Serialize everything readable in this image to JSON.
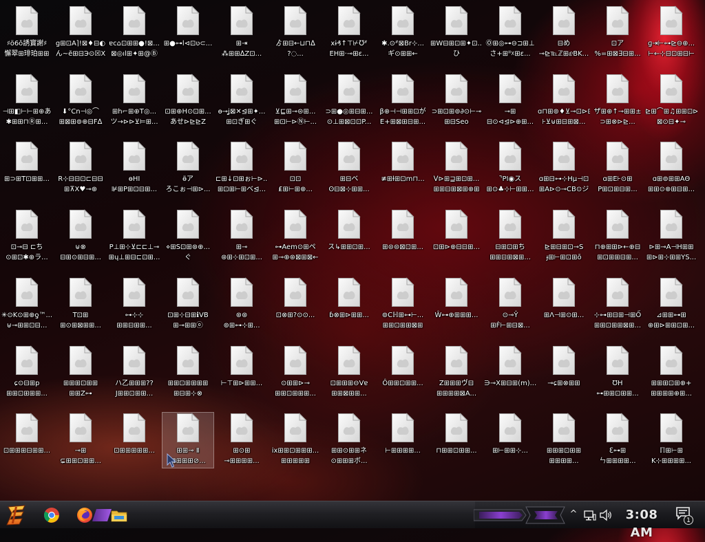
{
  "desktop": {
    "icon_type": "file-icon",
    "columns": 13,
    "icons": [
      {
        "line1": "♯ö6ǒ誘寳謝♯",
        "line2": "懈翠⊞琲珀⊞⊞"
      },
      {
        "line1": "g⊞⊡A⌉!⊠♦⊟◐",
        "line2": "ん~ẽ⊞⊟Э⊙☒X"
      },
      {
        "line1": "ɐc⌂⊡⊞⊞●!⊠...",
        "line2": "⊠◎ıl⊞✦⊞@Ⓑ"
      },
      {
        "line1": "⊞●⊶ⅼ⊲⊡ʋ⊂...",
        "line2": ""
      },
      {
        "line1": "⊞⇥",
        "line2": "⁂⊞⊞ᐃZ⊡..."
      },
      {
        "line1": "ゟ⊞⊟←⊔⊓ᐃ",
        "line2": "?◌..."
      },
      {
        "line1": "xɨ₰↑⊤⊬℧ᐥ",
        "line2": "EH⊞·⊸⊞ɛ..."
      },
      {
        "line1": "✱.⊙ᐥ⊠Br⊹...",
        "line2": "ギ⊙⊞⊞←"
      },
      {
        "line1": "⊞W⊟⊞⊡⊞✦⊡...",
        "line2": "ひ"
      },
      {
        "line1": "Ⓞ⊞◎⊶⊖⊐⊞⊥",
        "line2": "さ+⊞ᐦ☓⊞ɛ..."
      },
      {
        "line1": "⊟め",
        "line2": "⊸⊵℡ℤ⊞ⅇBK..."
      },
      {
        "line1": "⊡ア",
        "line2": "%=⊞⊠∃⊟⊞..."
      },
      {
        "line1": "ɡ⇥⊢⊶⊵⊖⊕...",
        "line2": "⊢←⊹⊟⊡⊞⊟⊢"
      },
      {
        "line1": "⊣⊞◧⊢⊢⊞⊕あ",
        "line2": "✱⊞⊞⊓Ⓡ⊞..."
      },
      {
        "line1": "⬇°Cn⊣◎⌒",
        "line2": "⊞⊠⊞⊚⊕⊟F∆"
      },
      {
        "line1": "⊞h⌐⊞⊕T◎...",
        "line2": "ツ→⊳⊳⊻⊨⊞..."
      },
      {
        "line1": "⊡⊞⊕H⊙⊡⊞...",
        "line2": "あせ⊳⊵⊵Z"
      },
      {
        "line1": "ɵ⊸ʝ⊠✕⊴⊞✦...",
        "line2": "⊞⊡ぎ⊞ぐ"
      },
      {
        "line1": "⊻⊑⊞⊸⊜⊞...",
        "line2": "⊞⊡⊢⊳Ⓝ⊢..."
      },
      {
        "line1": "⊃⊞●◎⊞⊟⊞...",
        "line2": "⊙⊥⊞⊠⊡⊡P..."
      },
      {
        "line1": "β⊕⊣⊣⊞⊞⊡が",
        "line2": "E+⊞⊠⊞⊟⊞..."
      },
      {
        "line1": "⊃⊞⊡⊞⊚∂⊙⊢⊸",
        "line2": "⊞⊟Seo"
      },
      {
        "line1": "⊸⊞",
        "line2": "⊟⊙⊲⊴⊳⊕⊞..."
      },
      {
        "line1": "ɑ⊓⊞⊚♦⊻⊸⊡⊳⊟",
        "line2": "⊦⊻⊎⊞⊟⊞⊠..."
      },
      {
        "line1": "ザ⊞⊕↑⊸⊞⊞±",
        "line2": "⊃⊞⊗⊳⊵..."
      },
      {
        "line1": "⊵⊞⌒⊞♫⊞⊞⊡⊳",
        "line2": "⊠⊙⊟✦⊸"
      },
      {
        "line1": "⊞⊃⊞T⊡⊞⊞...",
        "line2": ""
      },
      {
        "line1": "R⊹⊟⊟⊡⊏⊟⊟",
        "line2": "⊞⊼X♥⊸⊕"
      },
      {
        "line1": "ɵHI",
        "line2": "⊯⊞P⊞⊡⊟⊞..."
      },
      {
        "line1": "ɵ̃ア",
        "line2": "ろこぉ⊣⊞⊳..."
      },
      {
        "line1": "⊏⊞↓⊡⊞ぉ⊢⊳...",
        "line2": "⊞⊡⊞⊢⊞ベ⊴..."
      },
      {
        "line1": "⊡⊡",
        "line2": "₤⊞⊢⊞⊕..."
      },
      {
        "line1": "⊞⊟ベ",
        "line2": "ʘ⊟⊠⊹⊞⊞..."
      },
      {
        "line1": "≢⊞ƚ⊞⊡m⊓...",
        "line2": ""
      },
      {
        "line1": "ᐯ⊳⊞⊒⊞⊡⊞...",
        "line2": "⊞⊞⊟⊞⊠⊞⊕⊞"
      },
      {
        "line1": "⌝PI◉ス",
        "line2": "⊞⊙♣⊹⊢⊞⊞..."
      },
      {
        "line1": "ɑ⊞⊟⊶⊹Hμ⊣⊡",
        "line2": "⊞A⊳⊙⊸CB⊙ジ"
      },
      {
        "line1": "ɑ⊞E⊦⊙⊞",
        "line2": "P⊞⊡⊞⊟⊞..."
      },
      {
        "line1": "ɑ⊞⊚⊞⊞AΘ",
        "line2": "⊞⊞⊙⊕⊞⊟⊞..."
      },
      {
        "line1": "⊡⊸⊟ ⊏ち",
        "line2": "⊙⊞⊡✱⊕ラ..."
      },
      {
        "line1": "⊎⊗",
        "line2": "⊟⊞⊙⊞⊟⊞..."
      },
      {
        "line1": "P⊥⊞⊹⊻⊏⊏⊥⊸",
        "line2": "⊞ɥ⊥⊞⊟⊏⊡⊞..."
      },
      {
        "line1": "⋄⊞S⊡⊞⊛⊕...",
        "line2": "ぐ"
      },
      {
        "line1": "⊞⊸",
        "line2": "⊛⊞⊹⊞⊡⊞..."
      },
      {
        "line1": "⊶Aem⊙⊞ペ",
        "line2": "⊞⊸⊕⊛⊠⊞⊠←"
      },
      {
        "line1": "ス↳⊞⊞⊡⊞...",
        "line2": ""
      },
      {
        "line1": "⊞⊜⊜⊠⊡⊞...",
        "line2": ""
      },
      {
        "line1": "⊡⊞⊳⊕⊟⊟⊞...",
        "line2": ""
      },
      {
        "line1": "⊟⊞⊡⊞ち",
        "line2": "⊞⊞⊟⊞⊠⊞..."
      },
      {
        "line1": "⊵⊞⊟⊞⊡⊸S",
        "line2": "ɟ⊞⊢⊞⊡⊞ō"
      },
      {
        "line1": "⊓⊕⊞⊞⊳←⊕⊟",
        "line2": "⊞⊡⊞⊞⊟⊞..."
      },
      {
        "line1": "⊳⊞⊸A⊣H⊞⊞",
        "line2": "⊞⊳⊞⊹⊞⊞YS..."
      },
      {
        "line1": "✳⊙K⊙⊞⊕ƍ™...",
        "line2": "⊎⊸⊞⊞⊡⊟..."
      },
      {
        "line1": "T⊡⊞",
        "line2": "⊞⊙⊞⊠⊞⊞..."
      },
      {
        "line1": "⊶⊹⊹",
        "line2": "⊞⊞⊟⊞⊞..."
      },
      {
        "line1": "⊡⊞⊹⊟⊞ℹVB",
        "line2": "⊞⊸⊞⊞ⓞ"
      },
      {
        "line1": "⊛⊛",
        "line2": "⊚⊞⊶⊹⊞..."
      },
      {
        "line1": "⊡⊗⊞?⊙⊙...",
        "line2": ""
      },
      {
        "line1": "ɓ⊗⊞⊳⊞⊞...",
        "line2": ""
      },
      {
        "line1": "⊚Cℍ⊞⊶⊢...",
        "line2": "⊞⊞⊡⊞⊞⊠⊞"
      },
      {
        "line1": "Ŵ⊶⊕⊞⊞⊞...",
        "line2": ""
      },
      {
        "line1": "⊙⊸Ŷ",
        "line2": "⊞Ḟ⊢⊞⊟⊠..."
      },
      {
        "line1": "⊞Λ⊣⊞⊙⊞...",
        "line2": ""
      },
      {
        "line1": "⊹⊶⊞⊟⊞⊣⊞Ố",
        "line2": "⊞⊞⊡⊞⊞⊠⊞..."
      },
      {
        "line1": "⊿⊞⊞⊶⊞",
        "line2": "⊕⊞⊳⊞⊞⊡⊞..."
      },
      {
        "line1": "ɕ⊙⊟⊞p",
        "line2": "⊞⊞⊡⊞⊞⊞..."
      },
      {
        "line1": "⊞⊞⊞⊡⊞⊞",
        "line2": "⊞⊞Z⊶"
      },
      {
        "line1": "ハ乙⊞⊞⊞??",
        "line2": "J⊞⊞⊡⊞⊞..."
      },
      {
        "line1": "⊞⊞⊡⊞⊞⊞⊞",
        "line2": "⊞⊟⊞⊹⊗"
      },
      {
        "line1": "⊢⊤⊞⊳⊞⊞...",
        "line2": ""
      },
      {
        "line1": "⊙⊞⊞⊳⊸",
        "line2": "⊞⊞⊡⊞⊞⊞..."
      },
      {
        "line1": "⊡⊞⊞⊞⊖Vɐ",
        "line2": "⊞⊞⊠⊞⊞..."
      },
      {
        "line1": "Ô⊞⊞⊡⊞⊞...",
        "line2": ""
      },
      {
        "line1": "Z⊞⊞⊞ヴ⊟",
        "line2": "⊞⊞⊞⊞⊠A..."
      },
      {
        "line1": "∋⊸X⊞⊟⊞(m)...",
        "line2": ""
      },
      {
        "line1": "⊸ɕ⊞⊗⊞⊞",
        "line2": ""
      },
      {
        "line1": "ƱH",
        "line2": "⊶⊞⊞⊡⊞⊞..."
      },
      {
        "line1": "⊞⊞⊞⊡⊞⊕+",
        "line2": "⊞⊞⊞⊞⊕⊞..."
      },
      {
        "line1": "⊡⊞⊞⊞⊟⊞⊞...",
        "line2": ""
      },
      {
        "line1": "⊸⊞",
        "line2": "⊊⊞⊞⊡⊞⊞..."
      },
      {
        "line1": "⊡⊞⊞⊞⊞⊞...",
        "line2": ""
      },
      {
        "line1": "⊞⊞⊸ Ⅱ",
        "line2": "⊠⊞⊞⊞⊘...",
        "selected": true
      },
      {
        "line1": "⊞⊙⊞",
        "line2": "⊸⊞⊞⊞⊞..."
      },
      {
        "line1": "ix⊞⊞⊡⊞⊞⊞...",
        "line2": "⊞⊞⊞⊞⊞"
      },
      {
        "line1": "⊞⊞⊙⊞⊞ネ",
        "line2": "⊙⊞⊞⊞ボ..."
      },
      {
        "line1": "⊢⊞⊞⊞⊞...",
        "line2": ""
      },
      {
        "line1": "⊓⊞⊞⊡⊞⊞...",
        "line2": ""
      },
      {
        "line1": "⊞⊢⊞⊞⊹...",
        "line2": ""
      },
      {
        "line1": "⊞⊞⊞⊡⊞⊞",
        "line2": "⊞⊞⊞⊞..."
      },
      {
        "line1": "ℇ⊶⊞",
        "line2": "ㄣ⊞⊞⊞⊞..."
      },
      {
        "line1": "ℿ⊞⊢⊞",
        "line2": "K⊹⊞⊞⊞⊞..."
      }
    ]
  },
  "cursor": {
    "icon": "mouse-pointer-icon"
  },
  "taskbar": {
    "start_icon": "start-menu-icon",
    "pinned": [
      {
        "icon": "chrome-icon"
      },
      {
        "icon": "firefox-icon"
      },
      {
        "icon": "file-explorer-icon"
      }
    ],
    "tray": {
      "chevron_icon": "chevron-up-icon",
      "chevron_glyph": "^",
      "network_icon": "network-icon",
      "volume_icon": "volume-icon",
      "clock": "3:08 AM",
      "notification_icon": "notification-icon",
      "notification_count": "1"
    },
    "colors": {
      "accent": "#8a3fd0",
      "start": "#f0a020"
    }
  }
}
